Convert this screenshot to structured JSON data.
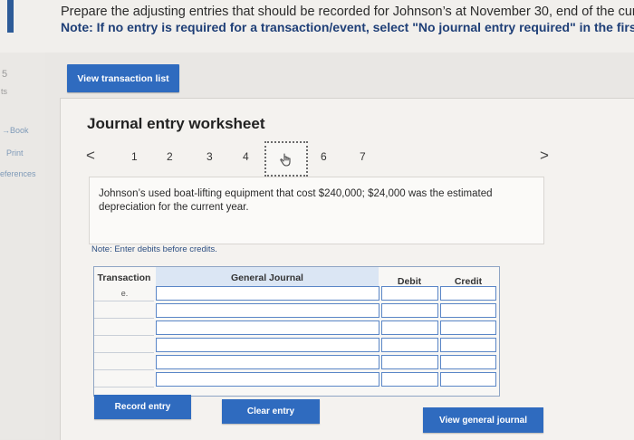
{
  "instructions": {
    "line1": "Prepare the adjusting entries that should be recorded for Johnson’s at November 30, end of the current",
    "note_label": "Note:",
    "note_text": " If no entry is required for a transaction/event, select \"No journal entry required\" in the first acc"
  },
  "sidebar": {
    "items": [
      {
        "label": "5"
      },
      {
        "label": "ts"
      },
      {
        "label": "Book"
      },
      {
        "label": "Print"
      },
      {
        "label": "eferences"
      }
    ]
  },
  "toolbar": {
    "view_transaction_list": "View transaction list"
  },
  "worksheet": {
    "title": "Journal entry worksheet",
    "pager": {
      "prev": "<",
      "next": ">",
      "pages": [
        "1",
        "2",
        "3",
        "4",
        "5",
        "6",
        "7"
      ],
      "current_index": 4
    },
    "description": "Johnson’s used boat-lifting equipment that cost $240,000; $24,000 was the estimated depreciation for the current year.",
    "note": "Note: Enter debits before credits.",
    "table": {
      "headers": {
        "transaction": "Transaction",
        "general_journal": "General Journal",
        "debit": "Debit",
        "credit": "Credit"
      },
      "rows": [
        {
          "transaction": "e.",
          "account": "",
          "debit": "",
          "credit": ""
        },
        {
          "transaction": "",
          "account": "",
          "debit": "",
          "credit": ""
        },
        {
          "transaction": "",
          "account": "",
          "debit": "",
          "credit": ""
        },
        {
          "transaction": "",
          "account": "",
          "debit": "",
          "credit": ""
        },
        {
          "transaction": "",
          "account": "",
          "debit": "",
          "credit": ""
        },
        {
          "transaction": "",
          "account": "",
          "debit": "",
          "credit": ""
        }
      ]
    },
    "buttons": {
      "record_entry": "Record entry",
      "clear_entry": "Clear entry",
      "view_general_journal": "View general journal"
    }
  },
  "colors": {
    "accent": "#2f6bbf",
    "note_blue": "#1f3f77"
  }
}
